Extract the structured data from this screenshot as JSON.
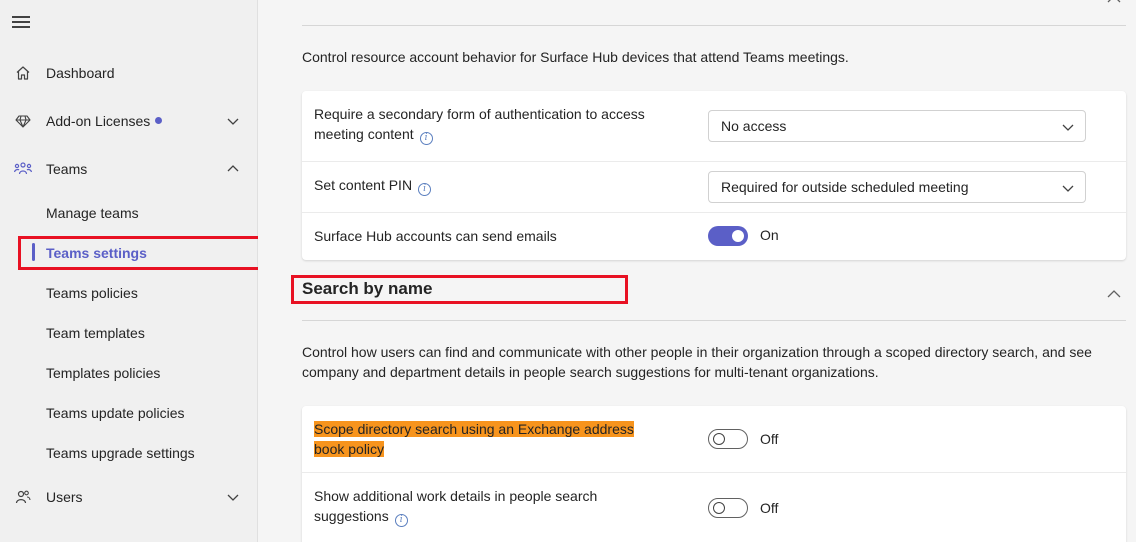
{
  "sidebar": {
    "menu_icon": "hamburger-icon",
    "items": [
      {
        "label": "Dashboard",
        "icon": "home-icon"
      },
      {
        "label": "Add-on Licenses",
        "icon": "diamond-icon",
        "has_dot": true
      },
      {
        "label": "Teams",
        "icon": "teams-icon"
      },
      {
        "label": "Users",
        "icon": "users-icon"
      }
    ],
    "teams_subitems": [
      {
        "label": "Manage teams"
      },
      {
        "label": "Teams settings"
      },
      {
        "label": "Teams policies"
      },
      {
        "label": "Team templates"
      },
      {
        "label": "Templates policies"
      },
      {
        "label": "Teams update policies"
      },
      {
        "label": "Teams upgrade settings"
      }
    ]
  },
  "surface_hub": {
    "description": "Control resource account behavior for Surface Hub devices that attend Teams meetings.",
    "rows": [
      {
        "label": "Require a secondary form of authentication to access meeting content",
        "value": "No access"
      },
      {
        "label": "Set content PIN",
        "value": "Required for outside scheduled meeting"
      },
      {
        "label": "Surface Hub accounts can send emails",
        "value": "On"
      }
    ]
  },
  "search_by_name": {
    "title": "Search by name",
    "description": "Control how users can find and communicate with other people in their organization through a scoped directory search, and see company and department details in people search suggestions for multi-tenant organizations.",
    "rows": [
      {
        "label": "Scope directory search using an Exchange address book policy",
        "value": "Off"
      },
      {
        "label": "Show additional work details in people search suggestions",
        "value": "Off"
      }
    ]
  },
  "colors": {
    "accent": "#5b5fc7",
    "highlight_box": "#e81123",
    "text_highlight": "#f7941d"
  }
}
